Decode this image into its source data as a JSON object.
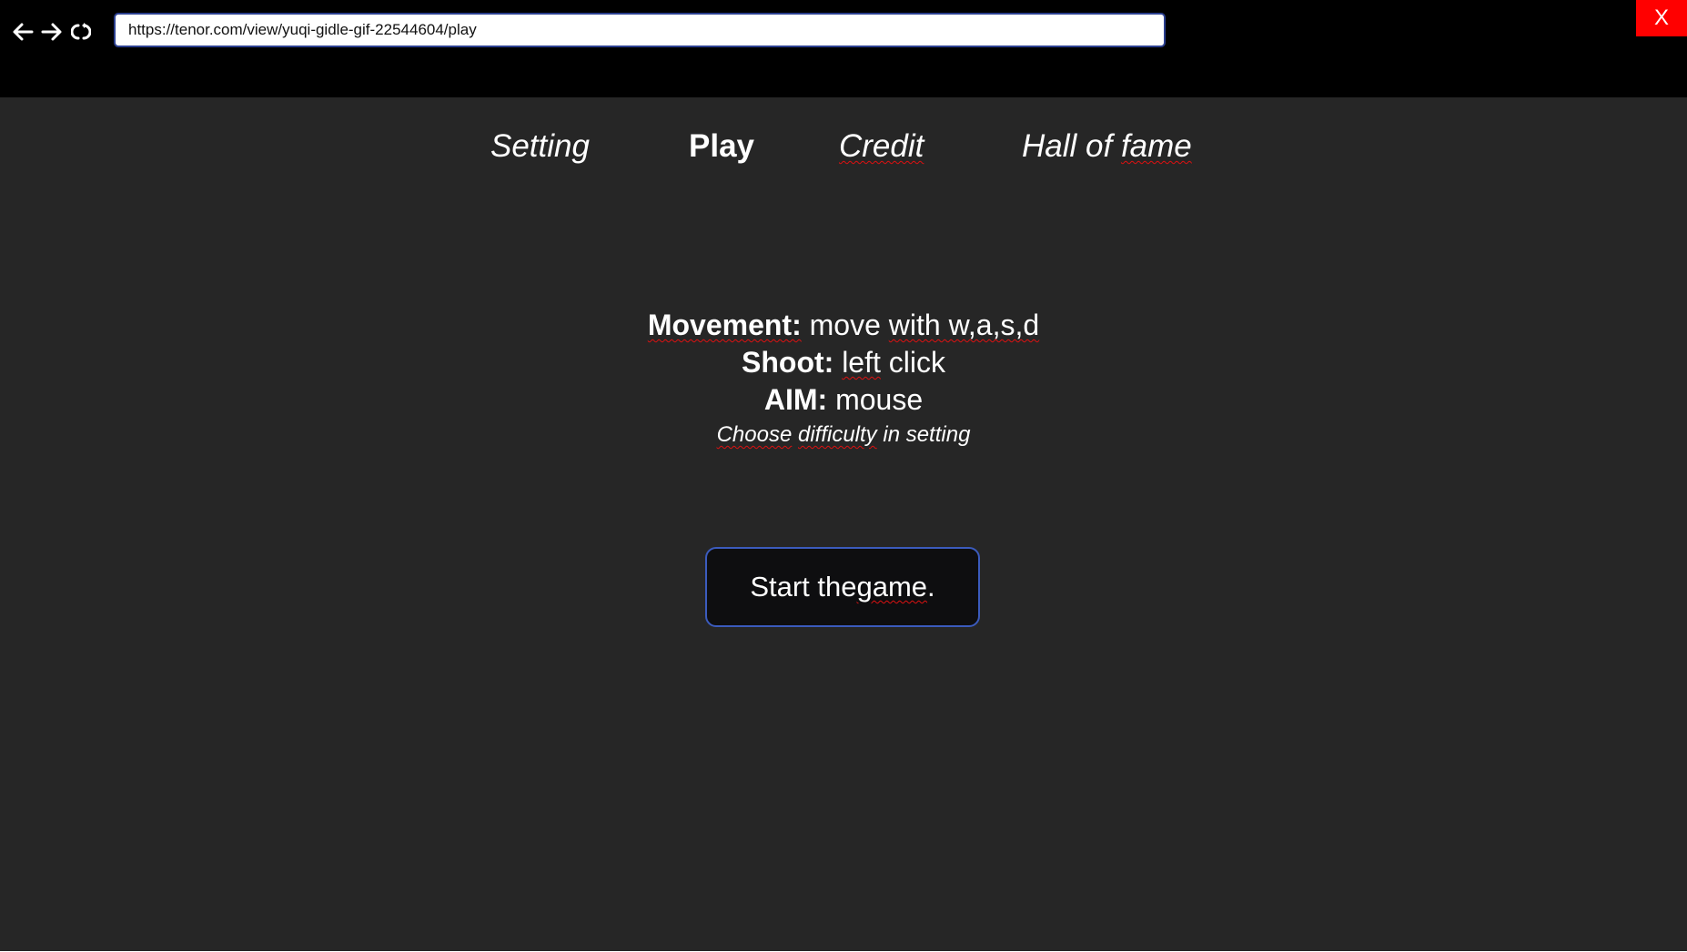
{
  "browser": {
    "url": "https://tenor.com/view/yuqi-gidle-gif-22544604/play",
    "close_label": "X",
    "back_icon": "arrow-left-icon",
    "forward_icon": "arrow-right-icon",
    "reload_icon": "reload-icon"
  },
  "menu": {
    "setting": "Setting",
    "play": "Play",
    "credit": "Credit",
    "hall_of": "Hall of ",
    "fame": "fame"
  },
  "instructions": {
    "movement_label": "Movement:",
    "movement_pre": " move ",
    "movement_word": "with w,a,s,d",
    "shoot_label": "Shoot:",
    "shoot_word": "left",
    "shoot_post": " click",
    "aim_label": "AIM:",
    "aim_value": " mouse",
    "note_choose": "Choose",
    "note_difficulty": "difficulty",
    "note_rest": " in setting"
  },
  "start_button": {
    "pre": "Start the ",
    "word": "game",
    "post": "."
  },
  "colors": {
    "topbar": "#000000",
    "content_bg": "#262626",
    "close_bg": "#ff0000",
    "url_border": "#2b3f8f",
    "button_border": "#3b5bbd"
  }
}
